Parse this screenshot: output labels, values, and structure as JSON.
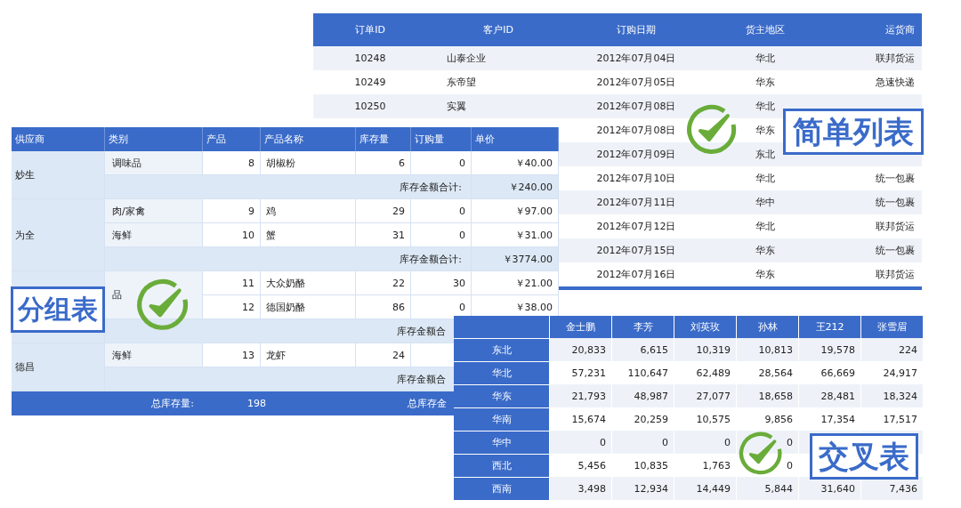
{
  "simple_list": {
    "label": "简单列表",
    "columns": [
      "订单ID",
      "客户ID",
      "订购日期",
      "货主地区",
      "运货商"
    ],
    "rows": [
      {
        "order_id": "10248",
        "customer_id": "山泰企业",
        "order_date": "2012年07月04日",
        "region": "华北",
        "carrier": "联邦货运"
      },
      {
        "order_id": "10249",
        "customer_id": "东帝望",
        "order_date": "2012年07月05日",
        "region": "华东",
        "carrier": "急速快递"
      },
      {
        "order_id": "10250",
        "customer_id": "实翼",
        "order_date": "2012年07月08日",
        "region": "华北"
      },
      {
        "order_date": "2012年07月08日",
        "region": "华东"
      },
      {
        "order_date": "2012年07月09日",
        "region": "东北"
      },
      {
        "order_date": "2012年07月10日",
        "region": "华北",
        "carrier": "统一包裹"
      },
      {
        "order_date": "2012年07月11日",
        "region": "华中",
        "carrier": "统一包裹"
      },
      {
        "order_date": "2012年07月12日",
        "region": "华北",
        "carrier": "联邦货运"
      },
      {
        "order_date": "2012年07月15日",
        "region": "华东",
        "carrier": "统一包裹"
      },
      {
        "order_date": "2012年07月16日",
        "region": "华东",
        "carrier": "联邦货运"
      }
    ]
  },
  "grouped_table": {
    "label": "分组表",
    "columns": [
      "供应商",
      "类别",
      "产品",
      "产品名称",
      "库存量",
      "订购量",
      "单价"
    ],
    "groups": [
      {
        "supplier": "妙生",
        "categories": [
          {
            "name": "调味品",
            "products": [
              {
                "id": "8",
                "name": "胡椒粉",
                "stock": "6",
                "ordered": "0",
                "price": "￥40.00"
              }
            ]
          }
        ],
        "subtotal_label": "库存金额合计:",
        "subtotal_value": "￥240.00"
      },
      {
        "supplier": "为全",
        "categories": [
          {
            "name": "肉/家禽",
            "products": [
              {
                "id": "9",
                "name": "鸡",
                "stock": "29",
                "ordered": "0",
                "price": "￥97.00"
              }
            ]
          },
          {
            "name": "海鲜",
            "products": [
              {
                "id": "10",
                "name": "蟹",
                "stock": "31",
                "ordered": "0",
                "price": "￥31.00"
              }
            ]
          }
        ],
        "subtotal_label": "库存金额合计:",
        "subtotal_value": "￥3774.00"
      },
      {
        "categories": [
          {
            "name": "品",
            "products": [
              {
                "id": "11",
                "name": "大众奶酪",
                "stock": "22",
                "ordered": "30",
                "price": "￥21.00"
              },
              {
                "id": "12",
                "name": "德国奶酪",
                "stock": "86",
                "ordered": "0",
                "price": "￥38.00"
              }
            ]
          }
        ],
        "subtotal_label": "库存金额合"
      },
      {
        "supplier": "德昌",
        "categories": [
          {
            "name": "海鲜",
            "products": [
              {
                "id": "13",
                "name": "龙虾",
                "stock": "24"
              }
            ]
          }
        ],
        "subtotal_label": "库存金额合"
      }
    ],
    "footer": {
      "total_stock_label": "总库存量:",
      "total_stock": "198",
      "total_value_label": "总库存金"
    }
  },
  "cross_table": {
    "label": "交叉表",
    "columns": [
      "金士鹏",
      "李芳",
      "刘英玫",
      "孙林",
      "王212",
      "张雪眉"
    ],
    "rows": [
      {
        "region": "东北",
        "values": [
          "20,833",
          "6,615",
          "10,319",
          "10,813",
          "19,578",
          "224"
        ]
      },
      {
        "region": "华北",
        "values": [
          "57,231",
          "110,647",
          "62,489",
          "28,564",
          "66,669",
          "24,917"
        ]
      },
      {
        "region": "华东",
        "values": [
          "21,793",
          "48,987",
          "27,077",
          "18,658",
          "28,481",
          "18,324"
        ]
      },
      {
        "region": "华南",
        "values": [
          "15,674",
          "20,259",
          "10,575",
          "9,856",
          "17,354",
          "17,517"
        ]
      },
      {
        "region": "华中",
        "values": [
          "0",
          "0",
          "0",
          "0"
        ]
      },
      {
        "region": "西北",
        "values": [
          "5,456",
          "10,835",
          "1,763",
          "0"
        ]
      },
      {
        "region": "西南",
        "values": [
          "3,498",
          "12,934",
          "14,449",
          "5,844",
          "31,640",
          "7,436"
        ]
      }
    ]
  }
}
